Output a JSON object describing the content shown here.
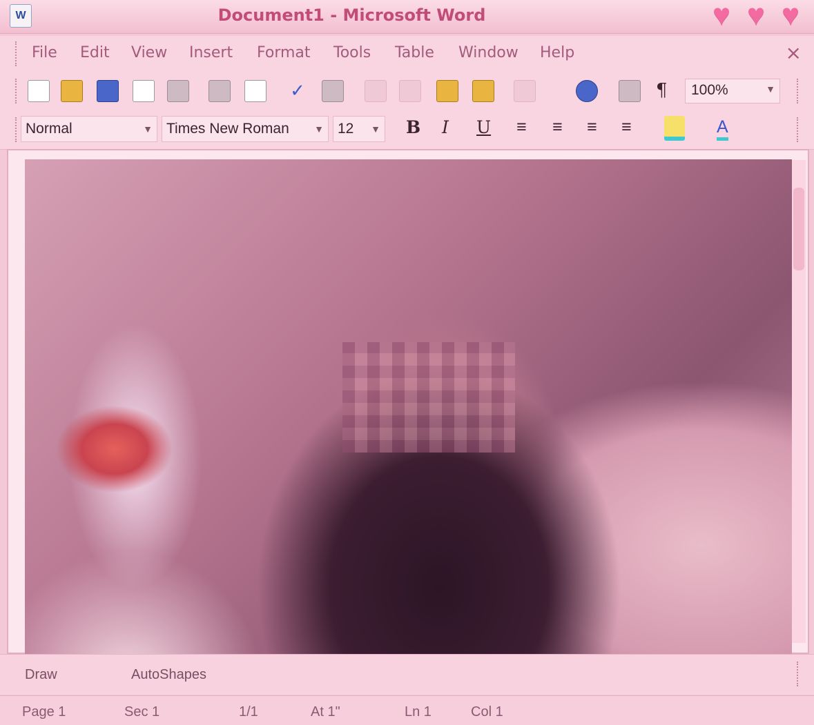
{
  "window": {
    "title": "Document1 - Microsoft Word",
    "icon_label": "W"
  },
  "menubar": {
    "items": [
      "File",
      "Edit",
      "View",
      "Insert",
      "Format",
      "Tools",
      "Table",
      "Window",
      "Help"
    ],
    "close_symbol": "×"
  },
  "standard_toolbar": {
    "paragraph_mark": "¶",
    "zoom": "100%"
  },
  "formatting_toolbar": {
    "style": "Normal",
    "font": "Times New Roman",
    "size": "12",
    "bold": "B",
    "italic": "I",
    "underline": "U",
    "font_color_symbol": "A"
  },
  "drawing_toolbar": {
    "draw_label": "Draw",
    "autoshapes_label": "AutoShapes"
  },
  "status_bar": {
    "page": "Page  1",
    "section": "Sec  1",
    "pages": "1/1",
    "at": "At  1\"",
    "line": "Ln  1",
    "column": "Col  1"
  },
  "colors": {
    "theme_pink": "#f4c9d7",
    "title_text": "#c24c78",
    "hearts": "#f26aa0"
  },
  "icons": [
    "new-document-icon",
    "open-icon",
    "save-icon",
    "permission-icon",
    "email-icon",
    "print-icon",
    "print-preview-icon",
    "spelling-icon",
    "research-icon",
    "cut-icon",
    "copy-icon",
    "paste-icon",
    "format-painter-icon",
    "undo-icon",
    "hyperlink-icon",
    "tables-borders-icon",
    "show-hide-icon",
    "align-left-icon",
    "center-icon",
    "align-right-icon",
    "justify-icon",
    "highlight-icon",
    "font-color-icon"
  ]
}
